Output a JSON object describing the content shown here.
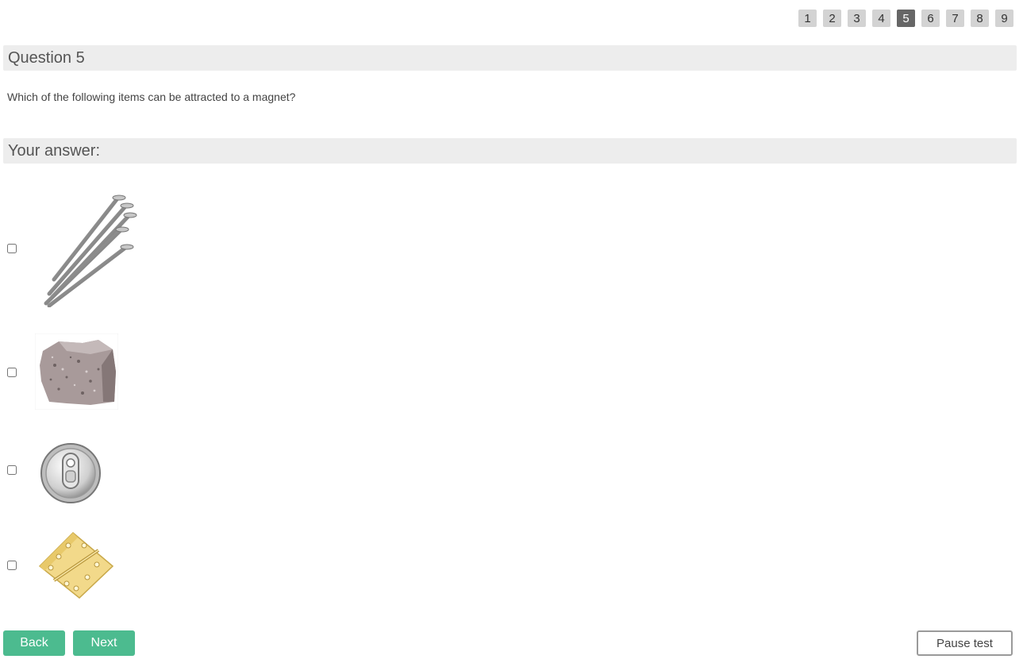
{
  "pagination": {
    "pages": [
      "1",
      "2",
      "3",
      "4",
      "5",
      "6",
      "7",
      "8",
      "9"
    ],
    "current": "5"
  },
  "question": {
    "header": "Question 5",
    "text": "Which of the following items can be attracted to a magnet?"
  },
  "answer": {
    "header": "Your answer:",
    "options": [
      {
        "image": "nails-icon",
        "checked": false
      },
      {
        "image": "rock-icon",
        "checked": false
      },
      {
        "image": "can-lid-icon",
        "checked": false
      },
      {
        "image": "brass-hinge-icon",
        "checked": false
      }
    ]
  },
  "buttons": {
    "back": "Back",
    "next": "Next",
    "pause": "Pause test"
  },
  "colors": {
    "accent": "#4cbb8f",
    "active_page": "#666666",
    "header_bg": "#ededed"
  }
}
